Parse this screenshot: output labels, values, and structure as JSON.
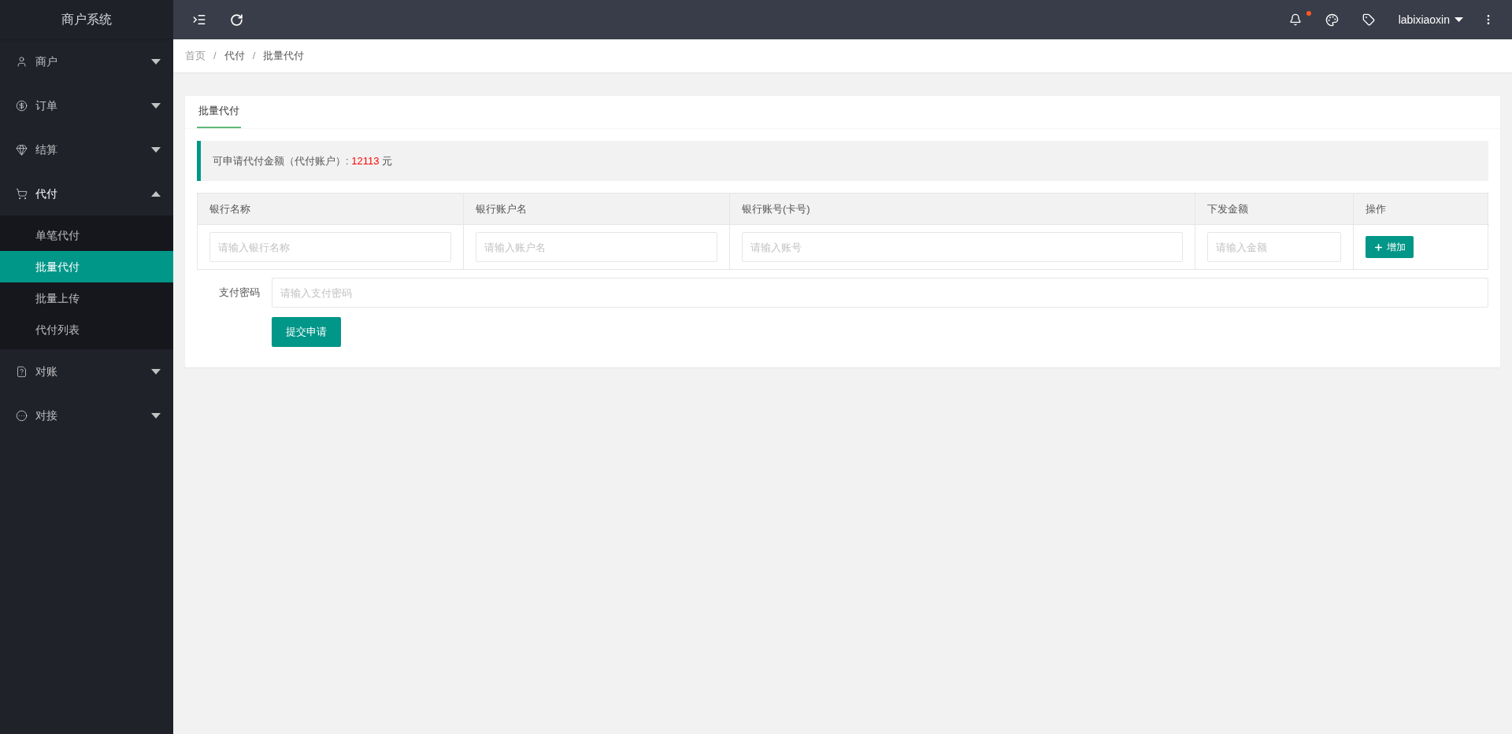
{
  "sidebar": {
    "title": "商户系统",
    "items": [
      {
        "label": "商户",
        "expanded": false
      },
      {
        "label": "订单",
        "expanded": false
      },
      {
        "label": "结算",
        "expanded": false
      },
      {
        "label": "代付",
        "expanded": true,
        "children": [
          {
            "label": "单笔代付",
            "selected": false
          },
          {
            "label": "批量代付",
            "selected": true
          },
          {
            "label": "批量上传",
            "selected": false
          },
          {
            "label": "代付列表",
            "selected": false
          }
        ]
      },
      {
        "label": "对账",
        "expanded": false
      },
      {
        "label": "对接",
        "expanded": false
      }
    ]
  },
  "header": {
    "notification_dot": true,
    "username": "labixiaoxin"
  },
  "breadcrumb": {
    "separator": "/",
    "items": [
      "首页",
      "代付",
      "批量代付"
    ]
  },
  "tabs": [
    {
      "label": "批量代付",
      "selected": true
    }
  ],
  "notice": {
    "text": "可申请代付金额（代付账户）:",
    "amount": "12113",
    "unit": "元"
  },
  "table": {
    "columns": [
      "银行名称",
      "银行账户名",
      "银行账号(卡号)",
      "下发金额",
      "操作"
    ],
    "row": {
      "placeholders": [
        "请输入银行名称",
        "请输入账户名",
        "请输入账号",
        "请输入金额"
      ],
      "action": "增加"
    }
  },
  "password": {
    "label": "支付密码",
    "placeholder": "请输入支付密码"
  },
  "submit": "提交申请"
}
